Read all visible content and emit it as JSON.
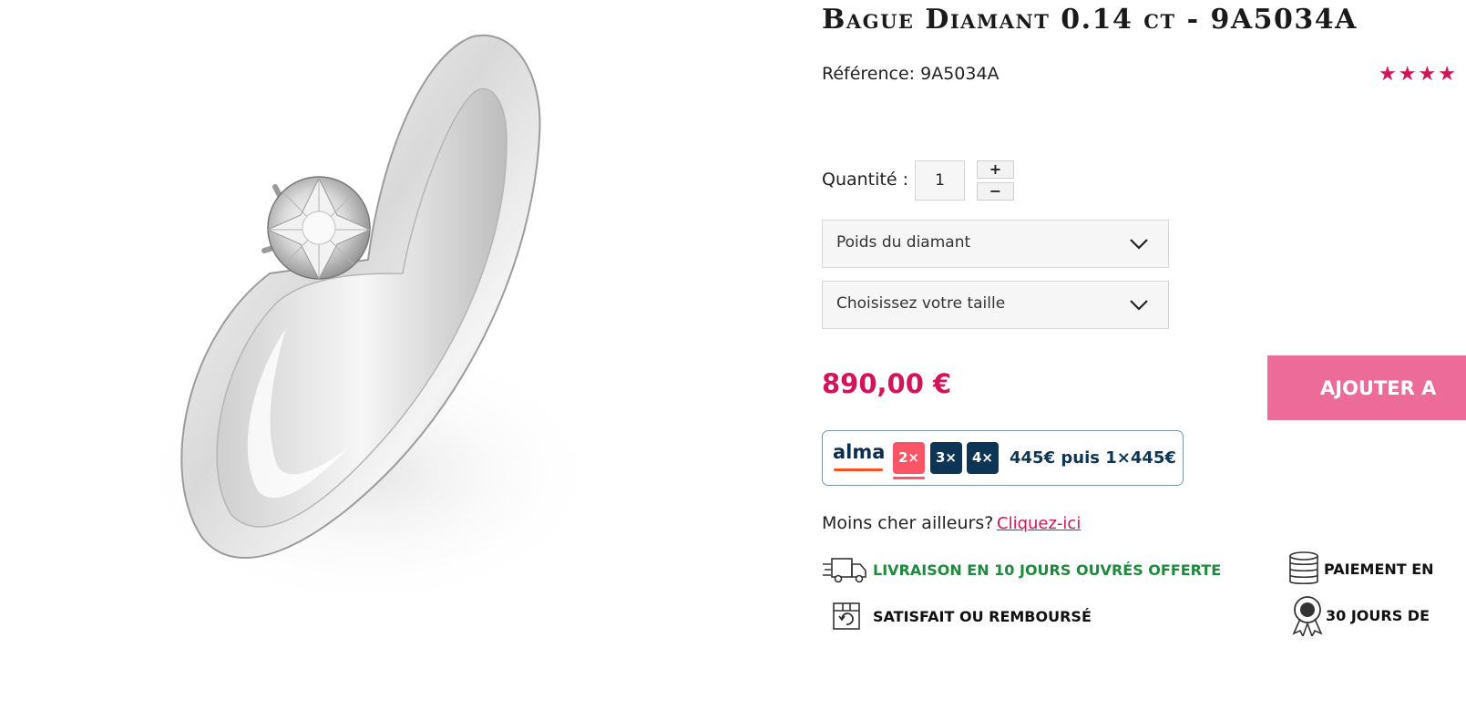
{
  "product": {
    "title": "Bague Diamant 0.14 ct - 9A5034A",
    "reference_label": "Référence: 9A5034A",
    "rating_stars": 4,
    "image_icon": "diamond-ring-image"
  },
  "quantity": {
    "label": "Quantité :",
    "value": "1",
    "plus": "+",
    "minus": "−"
  },
  "options": {
    "weight_label": "Poids du diamant",
    "size_label": "Choisissez votre taille"
  },
  "price": "890,00 €",
  "add_to_cart_label": "AJOUTER A",
  "alma": {
    "logo": "alma",
    "options": [
      "2×",
      "3×",
      "4×"
    ],
    "selected": "2×",
    "installment_text": "445€ puis 1×445€"
  },
  "cheaper": {
    "text": "Moins cher ailleurs?",
    "link": "Cliquez-ici"
  },
  "features": {
    "delivery": "LIVRAISON EN 10 JOURS OUVRÉS OFFERTE",
    "payment": "PAIEMENT EN",
    "refund": "SATISFAIT OU REMBOURSÉ",
    "days": "30 JOURS DE"
  },
  "colors": {
    "accent": "#d4145a",
    "button": "#ec6b98",
    "delivery_green": "#1f8a3e",
    "alma_navy": "#0d3555",
    "alma_red": "#fa5567"
  }
}
